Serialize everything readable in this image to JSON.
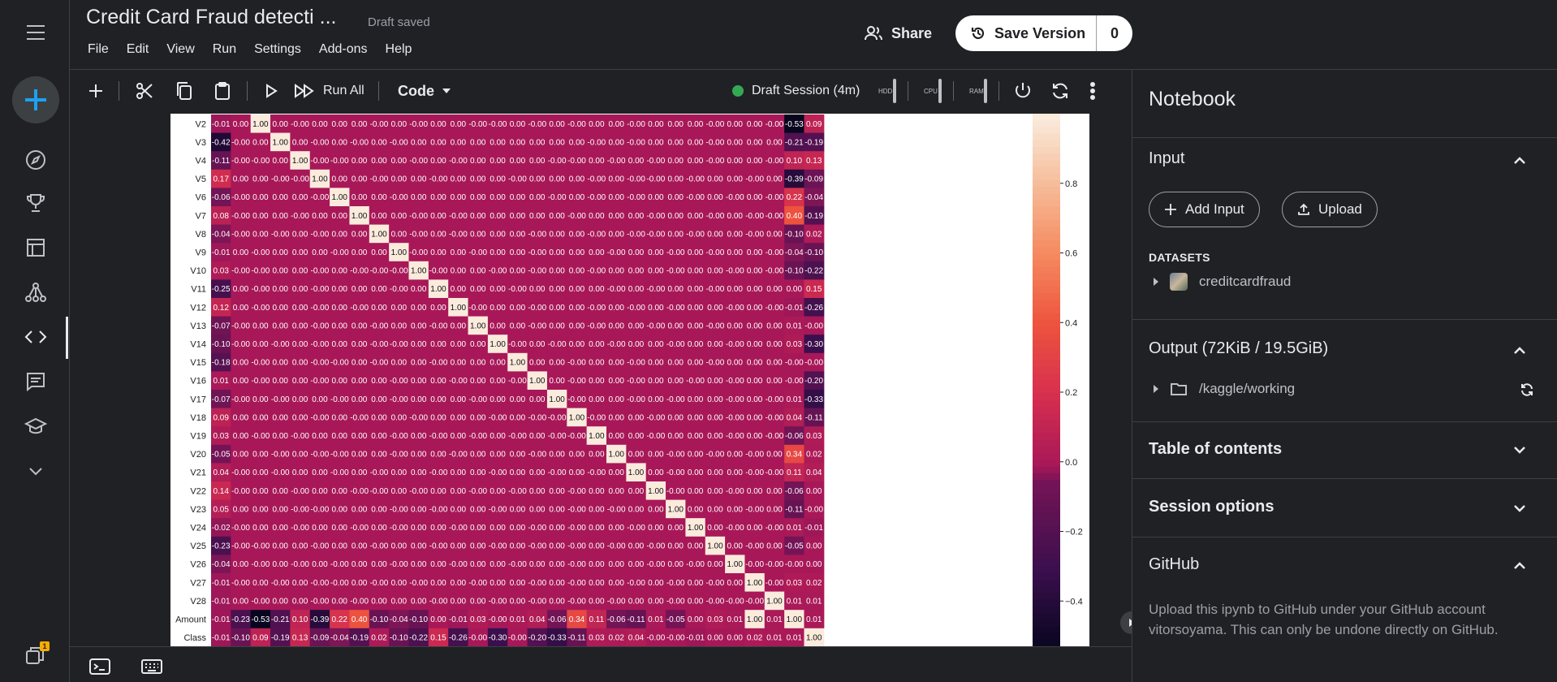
{
  "window": {
    "title": "Credit Card Fraud detecti ...",
    "save_status": "Draft saved"
  },
  "menu": [
    "File",
    "Edit",
    "View",
    "Run",
    "Settings",
    "Add-ons",
    "Help"
  ],
  "header": {
    "share_label": "Share",
    "save_version_label": "Save Version",
    "save_version_count": "0"
  },
  "toolbar": {
    "run_all_label": "Run All",
    "cell_type": "Code",
    "session_label": "Draft Session (4m)",
    "meters": [
      "HDD",
      "CPU",
      "RAM"
    ]
  },
  "chart_data": {
    "type": "heatmap",
    "rows": [
      "V2",
      "V3",
      "V4",
      "V5",
      "V6",
      "V7",
      "V8",
      "V9",
      "V10",
      "V11",
      "V12",
      "V13",
      "V14",
      "V15",
      "V16",
      "V17",
      "V18",
      "V19",
      "V20",
      "V21",
      "V22",
      "V23",
      "V24",
      "V25",
      "V26",
      "V27",
      "V28",
      "Amount",
      "Class"
    ],
    "columns_count": 31,
    "matrix": [
      [
        "-0.01",
        "0.00",
        "1.00",
        "0.00",
        "-0.00",
        "0.00",
        "0.00",
        "0.00",
        "-0.00",
        "0.00",
        "-0.00",
        "0.00",
        "0.00",
        "-0.00",
        "-0.00",
        "0.00",
        "-0.00",
        "0.00",
        "-0.00",
        "0.00",
        "0.00",
        "-0.00",
        "0.00",
        "0.00",
        "0.00",
        "-0.00",
        "0.00",
        "0.00",
        "-0.00",
        "-0.53",
        "0.09"
      ],
      [
        "-0.42",
        "-0.00",
        "0.00",
        "1.00",
        "0.00",
        "-0.00",
        "0.00",
        "-0.00",
        "0.00",
        "-0.00",
        "0.00",
        "0.00",
        "0.00",
        "0.00",
        "0.00",
        "0.00",
        "0.00",
        "0.00",
        "0.00",
        "-0.00",
        "0.00",
        "-0.00",
        "0.00",
        "0.00",
        "0.00",
        "-0.00",
        "0.00",
        "0.00",
        "0.00",
        "-0.21",
        "-0.19"
      ],
      [
        "-0.11",
        "-0.00",
        "-0.00",
        "0.00",
        "1.00",
        "-0.00",
        "-0.00",
        "0.00",
        "0.00",
        "0.00",
        "-0.00",
        "0.00",
        "-0.00",
        "0.00",
        "0.00",
        "0.00",
        "0.00",
        "-0.00",
        "-0.00",
        "0.00",
        "-0.00",
        "0.00",
        "-0.00",
        "0.00",
        "0.00",
        "-0.00",
        "0.00",
        "0.00",
        "-0.00",
        "0.10",
        "0.13"
      ],
      [
        "0.17",
        "0.00",
        "0.00",
        "-0.00",
        "-0.00",
        "1.00",
        "0.00",
        "0.00",
        "-0.00",
        "0.00",
        "0.00",
        "-0.00",
        "0.00",
        "0.00",
        "0.00",
        "-0.00",
        "0.00",
        "0.00",
        "0.00",
        "-0.00",
        "0.00",
        "-0.00",
        "-0.00",
        "0.00",
        "-0.00",
        "0.00",
        "0.00",
        "-0.00",
        "0.00",
        "-0.39",
        "-0.09"
      ],
      [
        "-0.06",
        "-0.00",
        "0.00",
        "0.00",
        "0.00",
        "-0.00",
        "1.00",
        "0.00",
        "0.00",
        "-0.00",
        "0.00",
        "0.00",
        "0.00",
        "0.00",
        "0.00",
        "0.00",
        "0.00",
        "-0.00",
        "0.00",
        "-0.00",
        "0.00",
        "-0.00",
        "0.00",
        "0.00",
        "-0.00",
        "0.00",
        "-0.00",
        "0.00",
        "-0.00",
        "0.22",
        "-0.04"
      ],
      [
        "0.08",
        "-0.00",
        "0.00",
        "0.00",
        "-0.00",
        "0.00",
        "0.00",
        "1.00",
        "0.00",
        "0.00",
        "-0.00",
        "0.00",
        "-0.00",
        "0.00",
        "0.00",
        "0.00",
        "0.00",
        "0.00",
        "-0.00",
        "0.00",
        "0.00",
        "0.00",
        "-0.00",
        "0.00",
        "0.00",
        "-0.00",
        "0.00",
        "-0.00",
        "-0.00",
        "0.40",
        "-0.19"
      ],
      [
        "-0.04",
        "-0.00",
        "0.00",
        "-0.00",
        "0.00",
        "-0.00",
        "0.00",
        "0.00",
        "1.00",
        "0.00",
        "-0.00",
        "0.00",
        "-0.00",
        "0.00",
        "0.00",
        "0.00",
        "-0.00",
        "0.00",
        "0.00",
        "-0.00",
        "0.00",
        "-0.00",
        "-0.00",
        "0.00",
        "-0.00",
        "0.00",
        "0.00",
        "-0.00",
        "0.00",
        "-0.10",
        "0.02"
      ],
      [
        "-0.01",
        "0.00",
        "-0.00",
        "0.00",
        "0.00",
        "0.00",
        "-0.00",
        "0.00",
        "0.00",
        "1.00",
        "-0.00",
        "0.00",
        "0.00",
        "-0.00",
        "0.00",
        "0.00",
        "-0.00",
        "0.00",
        "0.00",
        "0.00",
        "-0.00",
        "0.00",
        "0.00",
        "-0.00",
        "0.00",
        "-0.00",
        "0.00",
        "0.00",
        "-0.00",
        "-0.04",
        "-0.10"
      ],
      [
        "0.03",
        "-0.00",
        "-0.00",
        "0.00",
        "0.00",
        "-0.00",
        "0.00",
        "-0.00",
        "-0.00",
        "-0.00",
        "1.00",
        "-0.00",
        "0.00",
        "0.00",
        "-0.00",
        "0.00",
        "-0.00",
        "0.00",
        "0.00",
        "-0.00",
        "0.00",
        "0.00",
        "0.00",
        "-0.00",
        "0.00",
        "0.00",
        "-0.00",
        "0.00",
        "-0.00",
        "-0.10",
        "-0.22"
      ],
      [
        "-0.25",
        "0.00",
        "-0.00",
        "0.00",
        "0.00",
        "-0.00",
        "0.00",
        "0.00",
        "0.00",
        "-0.00",
        "0.00",
        "1.00",
        "0.00",
        "0.00",
        "0.00",
        "-0.00",
        "0.00",
        "0.00",
        "0.00",
        "0.00",
        "-0.00",
        "0.00",
        "-0.00",
        "0.00",
        "0.00",
        "-0.00",
        "0.00",
        "0.00",
        "0.00",
        "0.00",
        "0.15"
      ],
      [
        "0.12",
        "0.00",
        "-0.00",
        "0.00",
        "0.00",
        "-0.00",
        "0.00",
        "-0.00",
        "0.00",
        "0.00",
        "0.00",
        "0.00",
        "1.00",
        "-0.00",
        "0.00",
        "0.00",
        "-0.00",
        "0.00",
        "0.00",
        "-0.00",
        "0.00",
        "-0.00",
        "0.00",
        "-0.00",
        "0.00",
        "0.00",
        "-0.00",
        "0.00",
        "-0.00",
        "-0.01",
        "-0.26"
      ],
      [
        "-0.07",
        "-0.00",
        "0.00",
        "0.00",
        "0.00",
        "-0.00",
        "0.00",
        "0.00",
        "-0.00",
        "0.00",
        "0.00",
        "-0.00",
        "0.00",
        "1.00",
        "0.00",
        "0.00",
        "-0.00",
        "0.00",
        "0.00",
        "-0.00",
        "0.00",
        "0.00",
        "-0.00",
        "0.00",
        "0.00",
        "-0.00",
        "0.00",
        "0.00",
        "0.00",
        "0.01",
        "-0.00"
      ],
      [
        "-0.10",
        "-0.00",
        "0.00",
        "-0.00",
        "0.00",
        "-0.00",
        "0.00",
        "0.00",
        "-0.00",
        "-0.00",
        "0.00",
        "0.00",
        "0.00",
        "0.00",
        "1.00",
        "-0.00",
        "0.00",
        "-0.00",
        "0.00",
        "0.00",
        "-0.00",
        "0.00",
        "0.00",
        "-0.00",
        "0.00",
        "0.00",
        "-0.00",
        "0.00",
        "0.00",
        "0.03",
        "-0.30"
      ],
      [
        "-0.18",
        "0.00",
        "-0.00",
        "0.00",
        "0.00",
        "-0.00",
        "-0.00",
        "0.00",
        "-0.00",
        "0.00",
        "0.00",
        "-0.00",
        "0.00",
        "0.00",
        "0.00",
        "1.00",
        "0.00",
        "0.00",
        "-0.00",
        "0.00",
        "0.00",
        "-0.00",
        "0.00",
        "0.00",
        "0.00",
        "-0.00",
        "0.00",
        "0.00",
        "0.00",
        "-0.00",
        "-0.00"
      ],
      [
        "0.01",
        "0.00",
        "-0.00",
        "0.00",
        "0.00",
        "-0.00",
        "0.00",
        "0.00",
        "0.00",
        "-0.00",
        "0.00",
        "0.00",
        "-0.00",
        "0.00",
        "0.00",
        "-0.00",
        "1.00",
        "0.00",
        "-0.00",
        "0.00",
        "0.00",
        "-0.00",
        "0.00",
        "0.00",
        "-0.00",
        "0.00",
        "-0.00",
        "0.00",
        "0.00",
        "-0.00",
        "-0.20"
      ],
      [
        "-0.07",
        "-0.00",
        "0.00",
        "-0.00",
        "0.00",
        "0.00",
        "-0.00",
        "0.00",
        "0.00",
        "-0.00",
        "0.00",
        "0.00",
        "0.00",
        "-0.00",
        "0.00",
        "0.00",
        "0.00",
        "1.00",
        "-0.00",
        "0.00",
        "0.00",
        "-0.00",
        "0.00",
        "-0.00",
        "0.00",
        "0.00",
        "-0.00",
        "0.00",
        "-0.00",
        "0.01",
        "-0.33"
      ],
      [
        "0.09",
        "0.00",
        "0.00",
        "0.00",
        "0.00",
        "-0.00",
        "0.00",
        "-0.00",
        "0.00",
        "0.00",
        "-0.00",
        "0.00",
        "0.00",
        "0.00",
        "-0.00",
        "0.00",
        "-0.00",
        "-0.00",
        "1.00",
        "-0.00",
        "0.00",
        "0.00",
        "-0.00",
        "0.00",
        "0.00",
        "0.00",
        "-0.00",
        "0.00",
        "-0.00",
        "0.04",
        "-0.11"
      ],
      [
        "0.03",
        "0.00",
        "-0.00",
        "0.00",
        "-0.00",
        "0.00",
        "0.00",
        "0.00",
        "0.00",
        "-0.00",
        "0.00",
        "-0.00",
        "0.00",
        "-0.00",
        "0.00",
        "-0.00",
        "0.00",
        "-0.00",
        "-0.00",
        "1.00",
        "0.00",
        "0.00",
        "-0.00",
        "0.00",
        "0.00",
        "0.00",
        "-0.00",
        "0.00",
        "-0.00",
        "-0.06",
        "0.03"
      ],
      [
        "-0.05",
        "0.00",
        "0.00",
        "-0.00",
        "0.00",
        "-0.00",
        "-0.00",
        "0.00",
        "0.00",
        "-0.00",
        "0.00",
        "0.00",
        "-0.00",
        "0.00",
        "0.00",
        "0.00",
        "-0.00",
        "0.00",
        "0.00",
        "0.00",
        "1.00",
        "0.00",
        "0.00",
        "-0.00",
        "0.00",
        "-0.00",
        "0.00",
        "-0.00",
        "0.00",
        "0.34",
        "0.02"
      ],
      [
        "0.04",
        "-0.00",
        "0.00",
        "-0.00",
        "0.00",
        "0.00",
        "-0.00",
        "0.00",
        "-0.00",
        "0.00",
        "0.00",
        "-0.00",
        "0.00",
        "0.00",
        "-0.00",
        "0.00",
        "0.00",
        "-0.00",
        "0.00",
        "-0.00",
        "0.00",
        "1.00",
        "0.00",
        "-0.00",
        "0.00",
        "0.00",
        "0.00",
        "-0.00",
        "-0.00",
        "0.11",
        "0.04"
      ],
      [
        "0.14",
        "-0.00",
        "0.00",
        "0.00",
        "-0.00",
        "0.00",
        "0.00",
        "-0.00",
        "-0.00",
        "0.00",
        "-0.00",
        "0.00",
        "0.00",
        "-0.00",
        "0.00",
        "-0.00",
        "0.00",
        "0.00",
        "-0.00",
        "0.00",
        "0.00",
        "0.00",
        "1.00",
        "-0.00",
        "0.00",
        "0.00",
        "-0.00",
        "0.00",
        "0.00",
        "-0.06",
        "0.00"
      ],
      [
        "0.05",
        "0.00",
        "0.00",
        "0.00",
        "-0.00",
        "-0.00",
        "0.00",
        "0.00",
        "0.00",
        "-0.00",
        "0.00",
        "-0.00",
        "0.00",
        "0.00",
        "-0.00",
        "0.00",
        "0.00",
        "0.00",
        "-0.00",
        "0.00",
        "-0.00",
        "0.00",
        "0.00",
        "1.00",
        "0.00",
        "0.00",
        "0.00",
        "-0.00",
        "0.00",
        "-0.11",
        "-0.00"
      ],
      [
        "-0.02",
        "-0.00",
        "0.00",
        "0.00",
        "-0.00",
        "0.00",
        "0.00",
        "-0.00",
        "0.00",
        "-0.00",
        "0.00",
        "0.00",
        "-0.00",
        "0.00",
        "0.00",
        "0.00",
        "-0.00",
        "0.00",
        "-0.00",
        "0.00",
        "0.00",
        "-0.00",
        "0.00",
        "0.00",
        "1.00",
        "0.00",
        "-0.00",
        "0.00",
        "-0.00",
        "0.01",
        "-0.01"
      ],
      [
        "-0.23",
        "-0.00",
        "-0.00",
        "0.00",
        "0.00",
        "-0.00",
        "0.00",
        "0.00",
        "-0.00",
        "0.00",
        "0.00",
        "-0.00",
        "0.00",
        "0.00",
        "-0.00",
        "0.00",
        "-0.00",
        "0.00",
        "-0.00",
        "0.00",
        "-0.00",
        "0.00",
        "-0.00",
        "0.00",
        "0.00",
        "1.00",
        "0.00",
        "-0.00",
        "0.00",
        "-0.05",
        "0.00"
      ],
      [
        "-0.04",
        "0.00",
        "-0.00",
        "0.00",
        "-0.00",
        "0.00",
        "-0.00",
        "0.00",
        "0.00",
        "-0.00",
        "0.00",
        "0.00",
        "-0.00",
        "0.00",
        "0.00",
        "-0.00",
        "0.00",
        "0.00",
        "-0.00",
        "0.00",
        "0.00",
        "0.00",
        "-0.00",
        "0.00",
        "-0.00",
        "0.00",
        "1.00",
        "-0.00",
        "-0.00",
        "-0.00",
        "0.00"
      ],
      [
        "-0.01",
        "-0.00",
        "0.00",
        "-0.00",
        "0.00",
        "-0.00",
        "-0.00",
        "0.00",
        "-0.00",
        "0.00",
        "-0.00",
        "0.00",
        "0.00",
        "-0.00",
        "0.00",
        "0.00",
        "-0.00",
        "0.00",
        "-0.00",
        "0.00",
        "0.00",
        "-0.00",
        "0.00",
        "-0.00",
        "0.00",
        "-0.00",
        "0.00",
        "1.00",
        "-0.00",
        "0.03",
        "0.02"
      ],
      [
        "-0.01",
        "0.00",
        "-0.00",
        "0.00",
        "0.00",
        "-0.00",
        "0.00",
        "-0.00",
        "0.00",
        "0.00",
        "0.00",
        "-0.00",
        "0.00",
        "0.00",
        "-0.00",
        "0.00",
        "-0.00",
        "0.00",
        "-0.00",
        "0.00",
        "-0.00",
        "0.00",
        "0.00",
        "-0.00",
        "0.00",
        "-0.00",
        "-0.00",
        "-0.00",
        "1.00",
        "0.01",
        "0.01"
      ],
      [
        "-0.01",
        "-0.23",
        "-0.53",
        "-0.21",
        "0.10",
        "-0.39",
        "0.22",
        "0.40",
        "-0.10",
        "-0.04",
        "-0.10",
        "0.00",
        "-0.01",
        "0.03",
        "-0.00",
        "0.01",
        "0.04",
        "-0.06",
        "0.34",
        "0.11",
        "-0.06",
        "-0.11",
        "0.01",
        "-0.05",
        "0.00",
        "0.03",
        "0.01",
        "1.00",
        "0.01",
        "1.00",
        "0.01"
      ],
      [
        "-0.01",
        "-0.10",
        "0.09",
        "-0.19",
        "0.13",
        "-0.09",
        "-0.04",
        "-0.19",
        "0.02",
        "-0.10",
        "-0.22",
        "0.15",
        "-0.26",
        "-0.00",
        "-0.30",
        "-0.00",
        "-0.20",
        "-0.33",
        "-0.11",
        "0.03",
        "0.02",
        "0.04",
        "-0.00",
        "-0.00",
        "-0.01",
        "0.00",
        "0.00",
        "0.02",
        "0.01",
        "0.01",
        "1.00"
      ]
    ],
    "colorbar_ticks": [
      "0.8",
      "0.6",
      "0.4",
      "0.2",
      "0.0",
      "−0.2",
      "−0.4"
    ],
    "colorbar_values": [
      0.8,
      0.6,
      0.4,
      0.2,
      0.0,
      -0.2,
      -0.4
    ],
    "color_range": [
      -0.53,
      1.0
    ],
    "colormap": "rocket"
  },
  "panel": {
    "title": "Notebook",
    "input": {
      "title": "Input",
      "add_input_label": "Add Input",
      "upload_label": "Upload",
      "datasets_label": "DATASETS",
      "dataset_name": "creditcardfraud"
    },
    "output": {
      "title": "Output (72KiB / 19.5GiB)",
      "folder": "/kaggle/working"
    },
    "toc_title": "Table of contents",
    "session_options_title": "Session options",
    "github": {
      "title": "GitHub",
      "text": "Upload this ipynb to GitHub under your GitHub account vitorsoyama. This can only be undone directly on GitHub."
    }
  },
  "notifications": {
    "badge": "1"
  },
  "colors": {
    "bg": "#202124",
    "accent_plus": "#1da1f2",
    "session_dot": "#34a853"
  }
}
